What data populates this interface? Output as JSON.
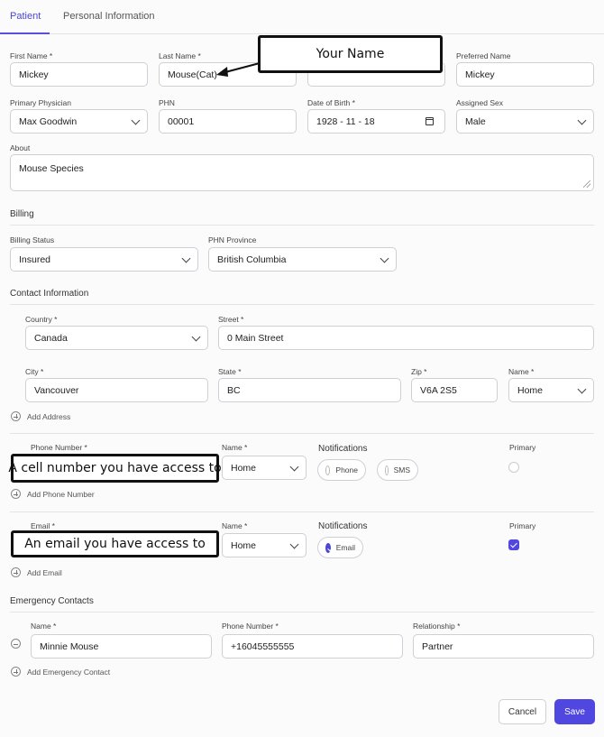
{
  "tabs": [
    {
      "label": "Patient",
      "active": true
    },
    {
      "label": "Personal Information",
      "active": false
    }
  ],
  "patient": {
    "first_name": {
      "label": "First Name *",
      "value": "Mickey"
    },
    "last_name": {
      "label": "Last Name *",
      "value": "Mouse(Cat)"
    },
    "preferred_name": {
      "label": "Preferred Name",
      "value": "Mickey"
    },
    "primary_physician": {
      "label": "Primary Physician",
      "value": "Max Goodwin"
    },
    "phn": {
      "label": "PHN",
      "value": "00001"
    },
    "dob": {
      "label": "Date of Birth *",
      "value": "1928 - 11 - 18"
    },
    "assigned_sex": {
      "label": "Assigned Sex",
      "value": "Male"
    },
    "about": {
      "label": "About",
      "value": "Mouse Species"
    }
  },
  "billing": {
    "title": "Billing",
    "status": {
      "label": "Billing Status",
      "value": "Insured"
    },
    "province": {
      "label": "PHN Province",
      "value": "British Columbia"
    }
  },
  "contact": {
    "title": "Contact Information",
    "country": {
      "label": "Country *",
      "value": "Canada"
    },
    "street": {
      "label": "Street *",
      "value": "0 Main Street"
    },
    "city": {
      "label": "City *",
      "value": "Vancouver"
    },
    "state": {
      "label": "State *",
      "value": "BC"
    },
    "zip": {
      "label": "Zip *",
      "value": "V6A 2S5"
    },
    "address_name": {
      "label": "Name *",
      "value": "Home"
    },
    "add_address": "Add Address",
    "phone": {
      "label": "Phone Number *",
      "name_label": "Name *",
      "name_value": "Home",
      "notifications_label": "Notifications",
      "opt_phone": "Phone",
      "opt_sms": "SMS",
      "primary_label": "Primary"
    },
    "add_phone": "Add Phone Number",
    "email": {
      "label": "Email *",
      "name_label": "Name *",
      "name_value": "Home",
      "notifications_label": "Notifications",
      "opt_email": "Email",
      "primary_label": "Primary"
    },
    "add_email": "Add Email"
  },
  "emergency": {
    "title": "Emergency Contacts",
    "name": {
      "label": "Name *",
      "value": "Minnie Mouse"
    },
    "phone": {
      "label": "Phone Number *",
      "value": "+16045555555"
    },
    "relationship": {
      "label": "Relationship *",
      "value": "Partner"
    },
    "add": "Add Emergency Contact"
  },
  "callouts": {
    "name": "Your Name",
    "phone": "A cell number you have access to",
    "email": "An email you have access to"
  },
  "actions": {
    "cancel": "Cancel",
    "save": "Save"
  },
  "colors": {
    "accent": "#5046e0",
    "border": "#cfcfd6"
  }
}
